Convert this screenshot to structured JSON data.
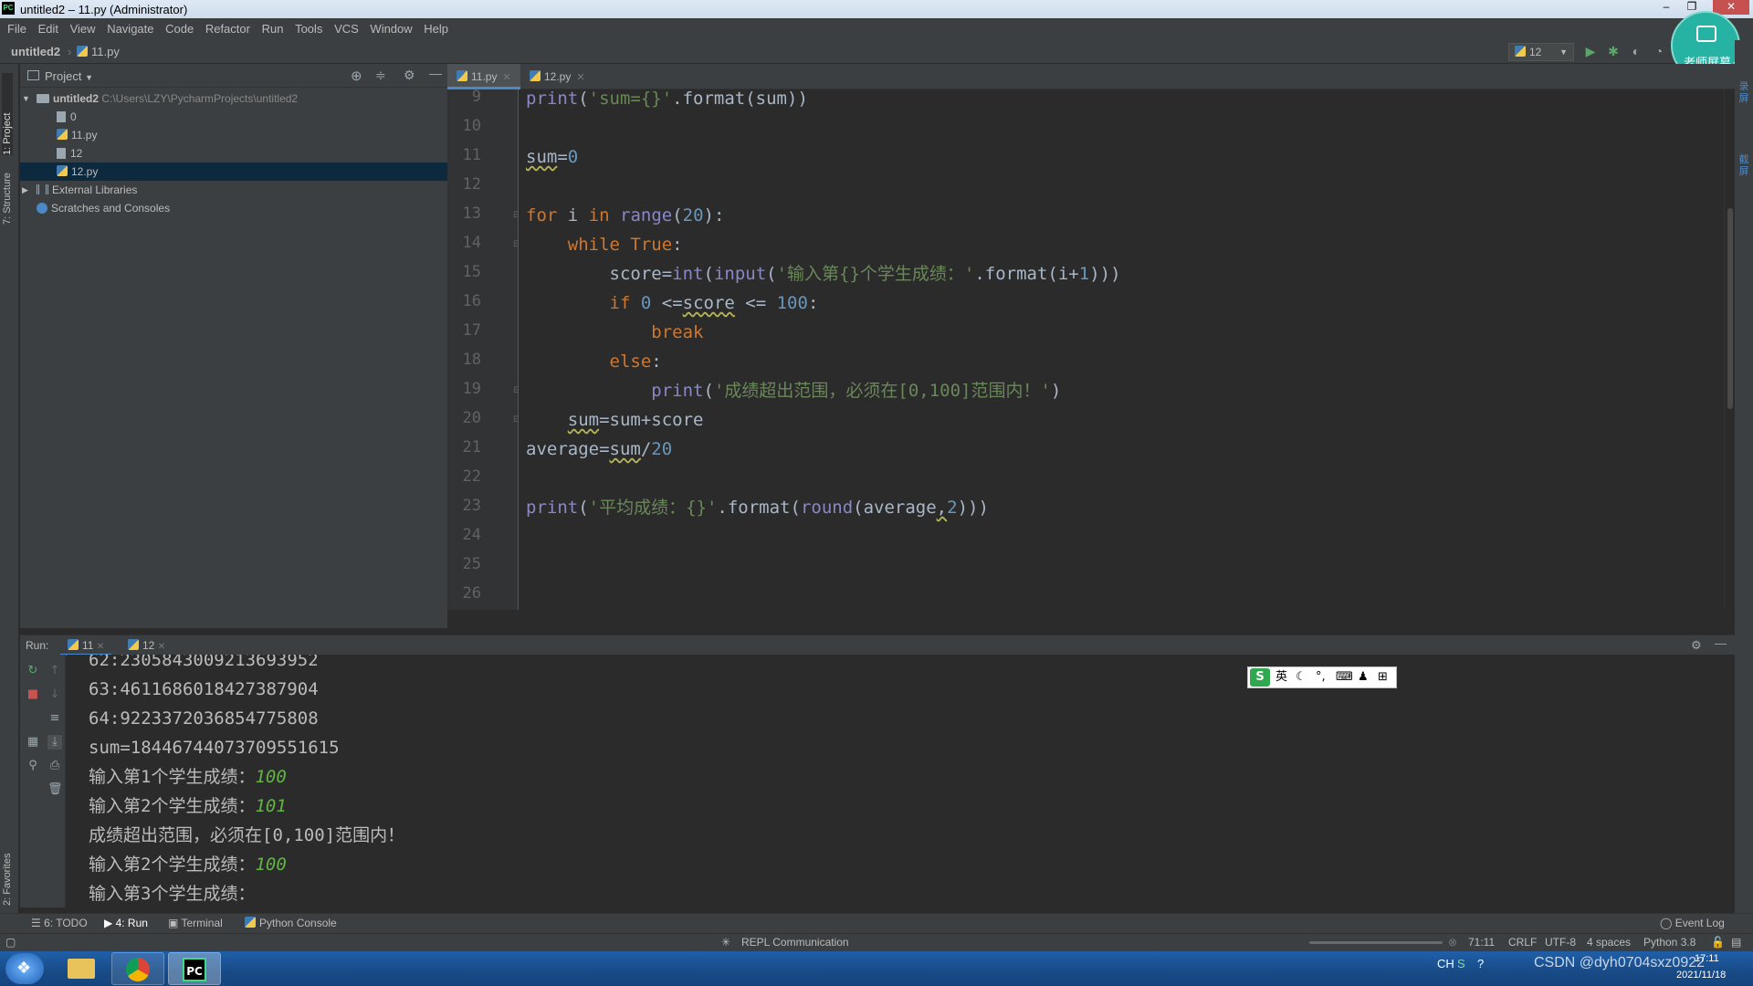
{
  "window": {
    "title": "untitled2 – 11.py (Administrator)"
  },
  "menu": [
    "File",
    "Edit",
    "View",
    "Navigate",
    "Code",
    "Refactor",
    "Run",
    "Tools",
    "VCS",
    "Window",
    "Help"
  ],
  "breadcrumb": {
    "project": "untitled2",
    "file": "11.py"
  },
  "run_config": "12",
  "project_panel": {
    "title": "Project",
    "root_name": "untitled2",
    "root_path": "C:\\Users\\LZY\\PycharmProjects\\untitled2",
    "items": [
      {
        "label": "0",
        "type": "file"
      },
      {
        "label": "11.py",
        "type": "py"
      },
      {
        "label": "12",
        "type": "file"
      },
      {
        "label": "12.py",
        "type": "py",
        "selected": true
      }
    ],
    "external_libraries": "External Libraries",
    "scratches": "Scratches and Consoles"
  },
  "left_strip": {
    "project": "1: Project",
    "structure": "7: Structure",
    "favorites": "2: Favorites"
  },
  "editor": {
    "tabs": [
      {
        "label": "11.py",
        "active": true
      },
      {
        "label": "12.py",
        "active": false
      }
    ],
    "line_numbers": [
      "9",
      "10",
      "11",
      "12",
      "13",
      "14",
      "15",
      "16",
      "17",
      "18",
      "19",
      "20",
      "21",
      "22",
      "23",
      "24",
      "25",
      "26"
    ]
  },
  "run_panel": {
    "label": "Run:",
    "tabs": [
      "11",
      "12"
    ],
    "output": [
      {
        "text": "62:2305843009213693952"
      },
      {
        "text": "63:4611686018427387904"
      },
      {
        "text": "64:9223372036854775808"
      },
      {
        "text": "sum=18446744073709551615"
      },
      {
        "text": "输入第1个学生成绩：",
        "input": "100"
      },
      {
        "text": "输入第2个学生成绩：",
        "input": "101"
      },
      {
        "text": "成绩超出范围，必须在[0,100]范围内！"
      },
      {
        "text": "输入第2个学生成绩：",
        "input": "100"
      },
      {
        "text": "输入第3个学生成绩："
      }
    ]
  },
  "ime_bar": {
    "mode": "英"
  },
  "overlay": {
    "record_button": "老师屏幕",
    "side_labels": [
      "录屏",
      "截屏"
    ]
  },
  "tool_tabs": [
    "6: TODO",
    "4: Run",
    "Terminal",
    "Python Console"
  ],
  "event_log": "Event Log",
  "status": {
    "repl": "REPL Communication",
    "position": "71:11",
    "line_sep": "CRLF",
    "encoding": "UTF-8",
    "indent": "4 spaces",
    "interpreter": "Python 3.8"
  },
  "taskbar": {
    "ime": "CH",
    "watermark": "CSDN @dyh0704sxz0922",
    "time": "17:11",
    "date": "2021/11/18"
  },
  "colors": {
    "keyword": "#cc7832",
    "number": "#6897bb",
    "string": "#6a8759",
    "builtin": "#8888c6",
    "user_input": "#62b543",
    "selection": "#0d293e",
    "tab_accent": "#4a88c7"
  }
}
